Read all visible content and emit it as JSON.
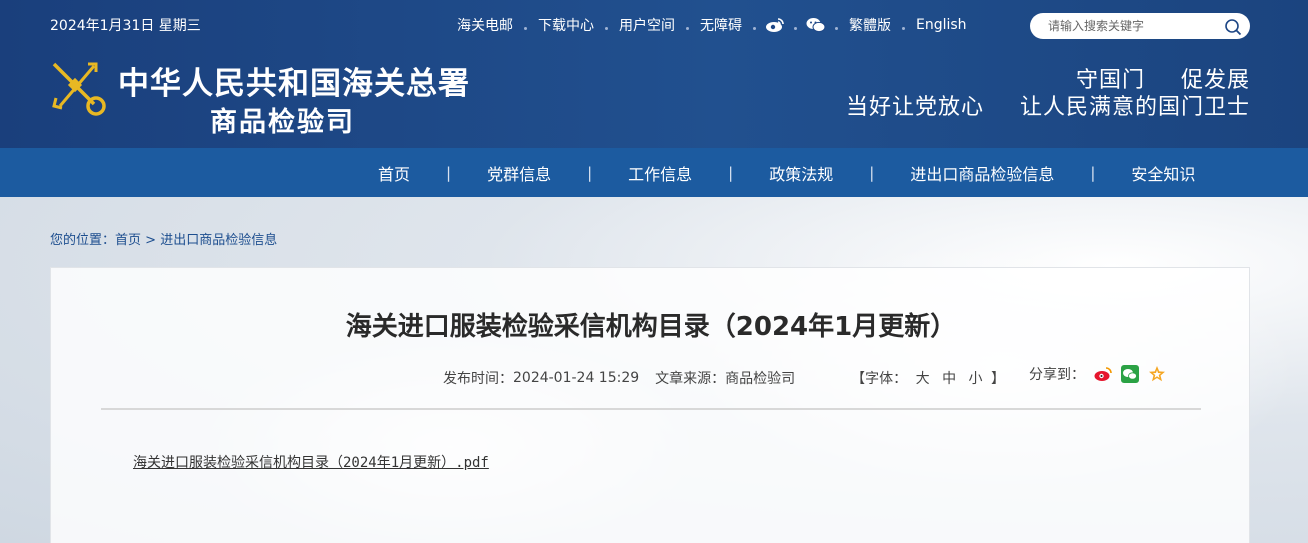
{
  "header": {
    "date": "2024年1月31日 星期三",
    "links": [
      "海关电邮",
      "下载中心",
      "用户空间",
      "无障碍"
    ],
    "icons": [
      "weibo-icon",
      "wechat-icon"
    ],
    "lang_links": [
      "繁體版",
      "English"
    ],
    "search_placeholder": "请输入搜索关键字",
    "site_title": "中华人民共和国海关总署",
    "site_subtitle": "商品检验司",
    "slogan_line1": [
      "守国门",
      "促发展"
    ],
    "slogan_line2": [
      "当好让党放心",
      "让人民满意的国门卫士"
    ]
  },
  "nav": {
    "items": [
      "首页",
      "党群信息",
      "工作信息",
      "政策法规",
      "进出口商品检验信息",
      "安全知识"
    ],
    "separator": "|"
  },
  "breadcrumb": {
    "prefix": "您的位置：",
    "home": "首页",
    "arrow": ">",
    "current": "进出口商品检验信息"
  },
  "article": {
    "title": "海关进口服装检验采信机构目录（2024年1月更新）",
    "publish_label": "发布时间：",
    "publish_time": "2024-01-24 15:29",
    "source_label": "文章来源：",
    "source": "商品检验司",
    "font_open": "【字体：",
    "font_sizes": [
      "大",
      "中",
      "小"
    ],
    "font_close": "】",
    "share_label": "分享到：",
    "attachment": "海关进口服装检验采信机构目录（2024年1月更新）.pdf"
  },
  "colors": {
    "header_bg": "#1d4685",
    "nav_bg": "#1c5ba0",
    "emblem_gold": "#e8b823",
    "link_blue": "#1d4e8f"
  }
}
